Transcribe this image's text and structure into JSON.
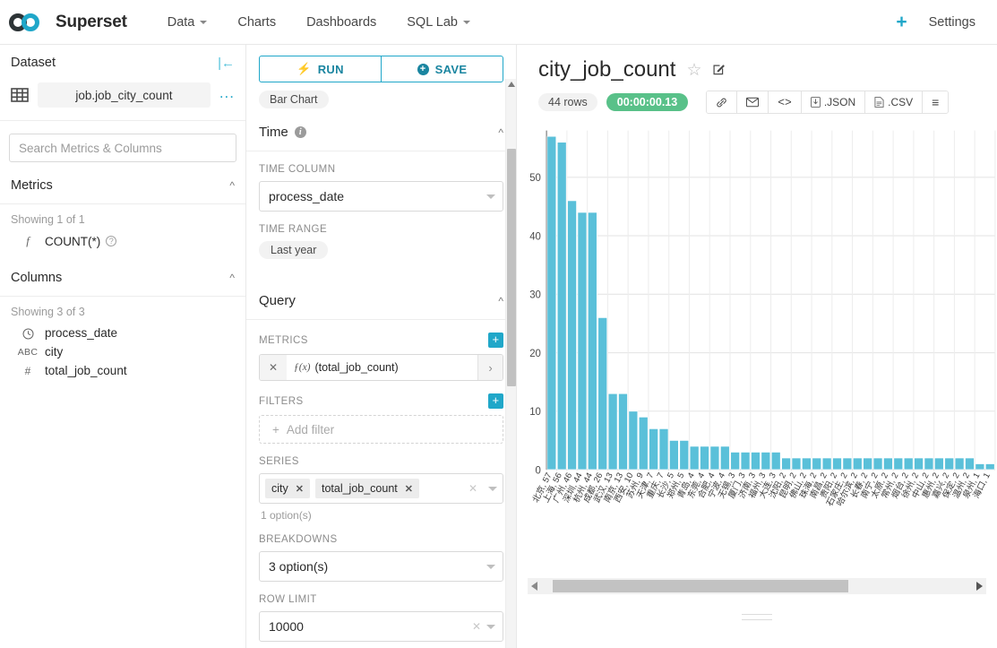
{
  "navbar": {
    "brand": "Superset",
    "items": [
      {
        "label": "Data",
        "caret": true
      },
      {
        "label": "Charts",
        "caret": false
      },
      {
        "label": "Dashboards",
        "caret": false
      },
      {
        "label": "SQL Lab",
        "caret": true
      }
    ],
    "plus_label": "+",
    "settings_label": "Settings"
  },
  "dataset_panel": {
    "title": "Dataset",
    "collapse_icon": "collapse-left-icon",
    "dataset_name": "job.job_city_count",
    "more_icon": "...",
    "search_placeholder": "Search Metrics & Columns",
    "search_value": "",
    "metrics": {
      "title": "Metrics",
      "showing": "Showing 1 of 1",
      "items": [
        {
          "icon": "f",
          "label": "COUNT(*)",
          "help": "?"
        }
      ]
    },
    "columns": {
      "title": "Columns",
      "showing": "Showing 3 of 3",
      "items": [
        {
          "icon": "clock",
          "label": "process_date"
        },
        {
          "icon": "ABC",
          "label": "city"
        },
        {
          "icon": "#",
          "label": "total_job_count"
        }
      ]
    }
  },
  "control_panel": {
    "run_label": "RUN",
    "save_label": "SAVE",
    "viz_type": "Bar Chart",
    "time_section": {
      "title": "Time",
      "time_column_label": "TIME COLUMN",
      "time_column_value": "process_date",
      "time_range_label": "TIME RANGE",
      "time_range_value": "Last year"
    },
    "query_section": {
      "title": "Query",
      "metrics_label": "METRICS",
      "metric_value": "(total_job_count)",
      "metric_fx": "ƒ(x)",
      "filters_label": "FILTERS",
      "add_filter_placeholder": "Add filter",
      "series_label": "SERIES",
      "series_tags": [
        "city",
        "total_job_count"
      ],
      "series_hint": "1 option(s)",
      "breakdowns_label": "BREAKDOWNS",
      "breakdowns_value": "3 option(s)",
      "row_limit_label": "ROW LIMIT",
      "row_limit_value": "10000"
    }
  },
  "chart": {
    "title": "city_job_count",
    "star_icon": "star-outline-icon",
    "edit_icon": "edit-pencil-icon",
    "rows_badge": "44 rows",
    "time_badge": "00:00:00.13",
    "time_badge_color": "#59c189",
    "bar_color": "#5ac0d9",
    "actions": [
      {
        "name": "link",
        "glyph": "ὑ7",
        "label": ""
      },
      {
        "name": "email",
        "glyph": "✉",
        "label": ""
      },
      {
        "name": "code",
        "glyph": "<>",
        "label": ""
      },
      {
        "name": "json",
        "glyph": "⬇",
        "label": ".JSON"
      },
      {
        "name": "csv",
        "glyph": "⬇",
        "label": ".CSV"
      },
      {
        "name": "menu",
        "glyph": "≡",
        "label": ""
      }
    ]
  },
  "chart_data": {
    "type": "bar",
    "title": "city_job_count",
    "xlabel": "",
    "ylabel": "",
    "ylim": [
      0,
      58
    ],
    "yticks": [
      0,
      10,
      20,
      30,
      40,
      50
    ],
    "grid": true,
    "legend": "none",
    "categories": [
      "北京, 57",
      "上海, 56",
      "广州, 46",
      "深圳, 44",
      "杭州, 44",
      "成都, 26",
      "武汉, 13",
      "南京, 13",
      "西安, 10",
      "苏州, 9",
      "天津, 7",
      "重庆, 7",
      "长沙, 5",
      "郑州, 5",
      "青岛, 4",
      "东莞, 4",
      "合肥, 4",
      "宁波, 4",
      "无锡, 3",
      "厦门, 3",
      "济南, 3",
      "福州, 3",
      "大连, 3",
      "沈阳, 2",
      "昆明, 2",
      "佛山, 2",
      "珠海, 2",
      "南昌, 2",
      "贵阳, 2",
      "石家庄, 2",
      "哈尔滨, 2",
      "长春, 2",
      "南宁, 2",
      "太原, 2",
      "常州, 2",
      "烟台, 2",
      "徐州, 2",
      "中山, 2",
      "惠州, 2",
      "嘉兴, 2",
      "保定, 2",
      "温州, 2",
      "泉州, 1",
      "海口, 1"
    ],
    "values": [
      57,
      56,
      46,
      44,
      44,
      26,
      13,
      13,
      10,
      9,
      7,
      7,
      5,
      5,
      4,
      4,
      4,
      4,
      3,
      3,
      3,
      3,
      3,
      2,
      2,
      2,
      2,
      2,
      2,
      2,
      2,
      2,
      2,
      2,
      2,
      2,
      2,
      2,
      2,
      2,
      2,
      2,
      1,
      1
    ]
  }
}
